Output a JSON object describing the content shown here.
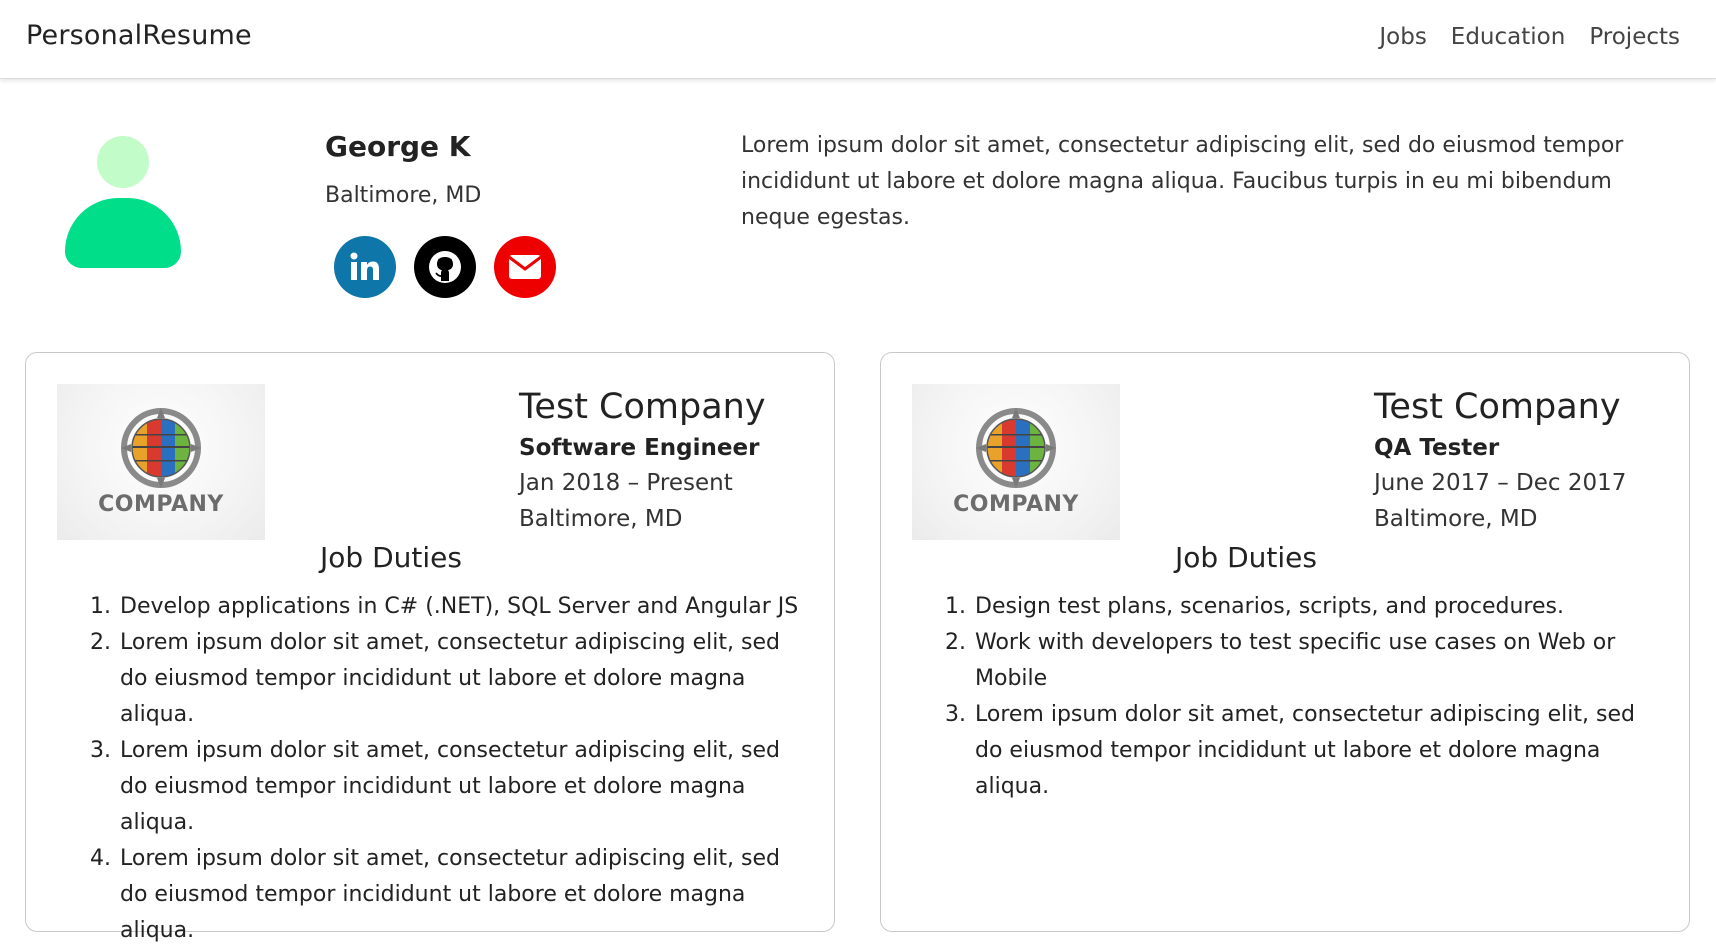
{
  "navbar": {
    "brand": "PersonalResume",
    "links": [
      "Jobs",
      "Education",
      "Projects"
    ]
  },
  "profile": {
    "name": "George K",
    "location": "Baltimore, MD",
    "bio": "Lorem ipsum dolor sit amet, consectetur adipiscing elit, sed do eiusmod tempor incididunt ut labore et dolore magna aliqua. Faucibus turpis in eu mi bibendum neque egestas.",
    "socials": [
      {
        "name": "linkedin",
        "icon": "linkedin-icon",
        "color": "#0e76a8"
      },
      {
        "name": "github",
        "icon": "github-icon",
        "color": "#000000"
      },
      {
        "name": "email",
        "icon": "envelope-icon",
        "color": "#ee0000"
      }
    ],
    "avatar_colors": {
      "head": "#c2fcc8",
      "body": "#00de8a"
    }
  },
  "jobs": [
    {
      "logo_text": "COMPANY",
      "company": "Test Company",
      "role": "Software Engineer",
      "dates": "Jan 2018 – Present",
      "location": "Baltimore, MD",
      "duties_title": "Job Duties",
      "duties": [
        "Develop applications in C# (.NET), SQL Server and Angular JS",
        "Lorem ipsum dolor sit amet, consectetur adipiscing elit, sed do eiusmod tempor incididunt ut labore et dolore magna aliqua.",
        "Lorem ipsum dolor sit amet, consectetur adipiscing elit, sed do eiusmod tempor incididunt ut labore et dolore magna aliqua.",
        "Lorem ipsum dolor sit amet, consectetur adipiscing elit, sed do eiusmod tempor incididunt ut labore et dolore magna aliqua."
      ]
    },
    {
      "logo_text": "COMPANY",
      "company": "Test Company",
      "role": "QA Tester",
      "dates": "June 2017 – Dec 2017",
      "location": "Baltimore, MD",
      "duties_title": "Job Duties",
      "duties": [
        "Design test plans, scenarios, scripts, and procedures.",
        "Work with developers to test specific use cases on Web or Mobile",
        "Lorem ipsum dolor sit amet, consectetur adipiscing elit, sed do eiusmod tempor incididunt ut labore et dolore magna aliqua."
      ]
    }
  ]
}
